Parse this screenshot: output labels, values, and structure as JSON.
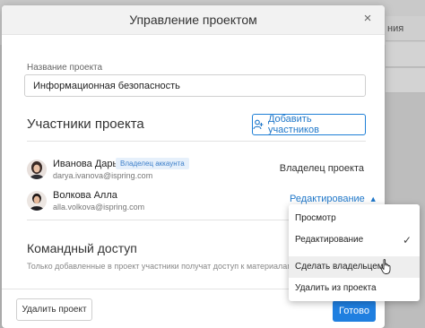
{
  "background": {
    "column_header_partial": "ния"
  },
  "modal": {
    "title": "Управление проектом",
    "close_glyph": "×"
  },
  "project_name": {
    "label": "Название проекта",
    "value": "Информационная безопасность"
  },
  "participants": {
    "title": "Участники проекта",
    "add_button_label": "Добавить участников",
    "members": [
      {
        "name": "Иванова Дарья",
        "badge": "Владелец аккаунта",
        "email": "darya.ivanova@ispring.com",
        "role": "Владелец проекта"
      },
      {
        "name": "Волкова Алла",
        "email": "alla.volkova@ispring.com",
        "role": "Редактирование",
        "role_chevron": "▲"
      }
    ]
  },
  "team_access": {
    "title": "Командный доступ",
    "description": "Только добавленные в проект участники получат доступ к материалам"
  },
  "footer": {
    "delete_label": "Удалить проект",
    "done_label": "Готово"
  },
  "role_menu": {
    "items": [
      {
        "label": "Просмотр"
      },
      {
        "label": "Редактирование",
        "checked": true,
        "check_glyph": "✓"
      },
      {
        "label": "Сделать владельцем"
      },
      {
        "label": "Удалить из проекта"
      }
    ]
  },
  "colors": {
    "accent": "#1f77c9",
    "primary_button": "#1f7fe0",
    "badge_bg": "#e6f0fb",
    "overlay": "#bdbdbd"
  },
  "icons": {
    "close": "close-icon",
    "add_user": "add-user-icon",
    "chevron": "chevron-up-icon",
    "check": "check-icon",
    "cursor": "hand-cursor-icon"
  }
}
